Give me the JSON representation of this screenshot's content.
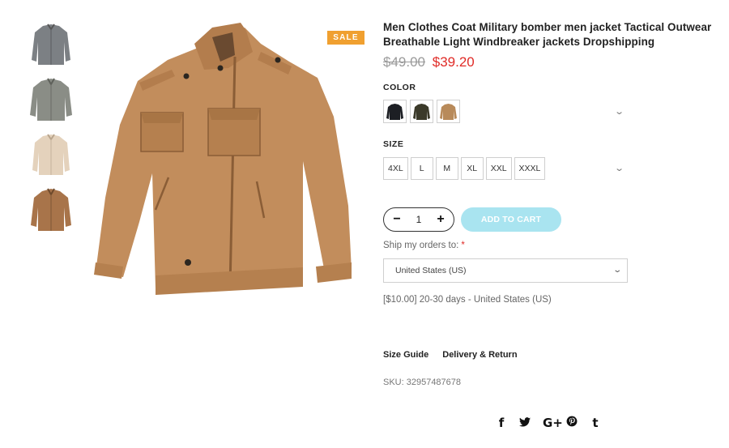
{
  "product": {
    "title": "Men Clothes Coat Military bomber men jacket Tactical Outwear Breathable Light Windbreaker jackets Dropshipping",
    "old_price": "$49.00",
    "new_price": "$39.20",
    "badge": "SALE",
    "sku_text": "SKU: 32957487678"
  },
  "thumbnails": [
    {
      "color_name": "gray"
    },
    {
      "color_name": "gray-green"
    },
    {
      "color_name": "beige"
    },
    {
      "color_name": "khaki"
    }
  ],
  "options": {
    "color_label": "COLOR",
    "colors": [
      {
        "name": "black",
        "hex": "#1d1f24"
      },
      {
        "name": "army-green",
        "hex": "#3b3a2a"
      },
      {
        "name": "khaki",
        "hex": "#b88a5a"
      }
    ],
    "size_label": "SIZE",
    "sizes": [
      "4XL",
      "L",
      "M",
      "XL",
      "XXL",
      "XXXL"
    ]
  },
  "cart": {
    "minus": "−",
    "plus": "+",
    "quantity": "1",
    "add_label": "ADD TO CART"
  },
  "shipping": {
    "label": "Ship my orders to:",
    "required_mark": "*",
    "selected": "United States (US)",
    "info": "[$10.00] 20-30 days - United States (US)"
  },
  "links": {
    "size_guide": "Size Guide",
    "delivery": "Delivery & Return"
  },
  "social": {
    "facebook": "f",
    "twitter": "🐦",
    "google": "G+",
    "pinterest": "℗",
    "tumblr": "t"
  },
  "colors": {
    "accent_sale": "#f0a030",
    "price_red": "#e02b27",
    "cart_button": "#a9e4f0",
    "jacket_main": "#c28d5c"
  }
}
